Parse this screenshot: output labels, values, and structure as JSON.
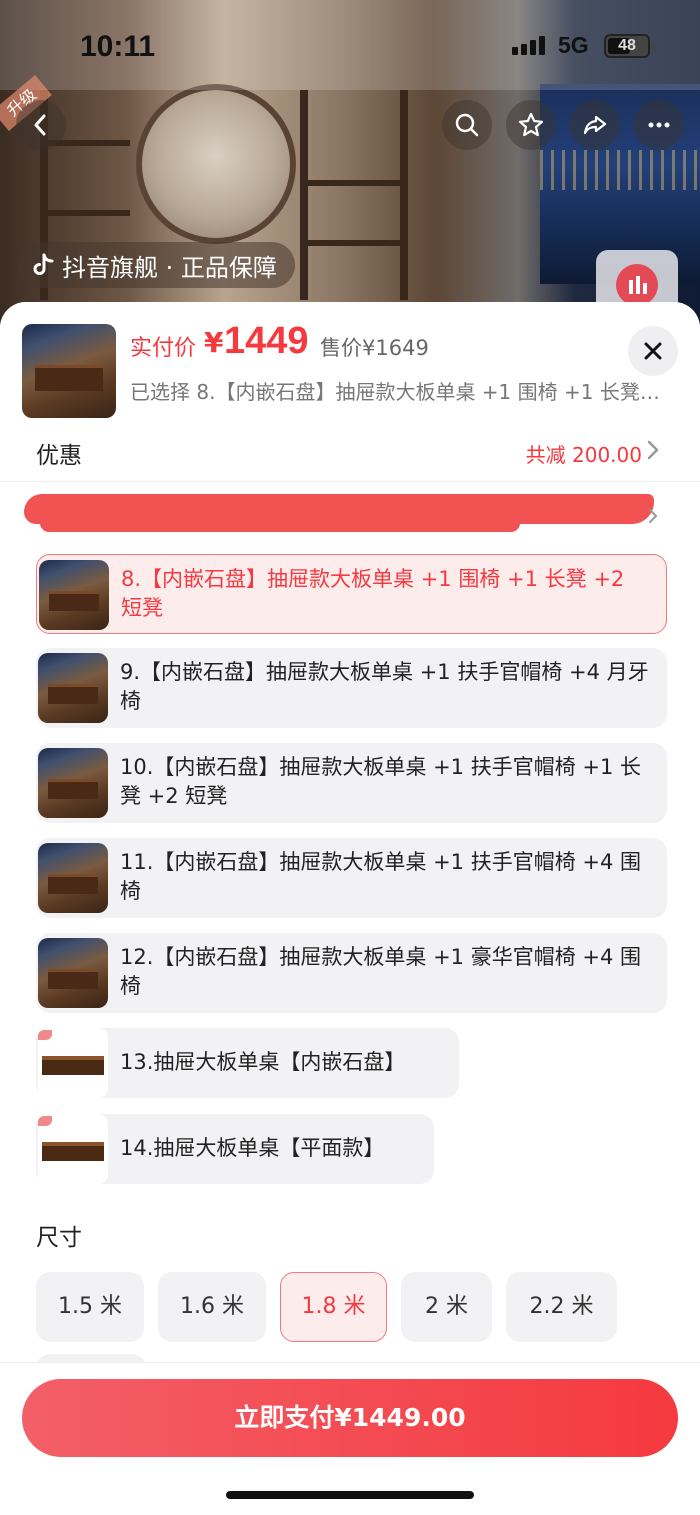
{
  "status_bar": {
    "time": "10:11",
    "network": "5G",
    "battery": "48"
  },
  "header_photo": {
    "badge_text": "升级",
    "store_label": "抖音旗舰 · 正品保障",
    "icons": [
      "back-icon",
      "search-icon",
      "star-icon",
      "share-icon",
      "more-icon"
    ]
  },
  "sheet": {
    "price_label": "实付价",
    "price_yen": "¥",
    "price_value": "1449",
    "original_price": "售价¥1649",
    "selected_summary": "已选择 8.【内嵌石盘】抽屉款大板单桌 +1 围椅 +1 长凳 +...",
    "discount_label": "优惠",
    "discount_value": "共减 200.00",
    "options": [
      {
        "label": "8.【内嵌石盘】抽屉款大板单桌 +1 围椅 +1 长凳 +2 短凳",
        "selected": true
      },
      {
        "label": "9.【内嵌石盘】抽屉款大板单桌 +1 扶手官帽椅 +4 月牙椅",
        "selected": false
      },
      {
        "label": "10.【内嵌石盘】抽屉款大板单桌 +1 扶手官帽椅 +1 长凳 +2 短凳",
        "selected": false
      },
      {
        "label": "11.【内嵌石盘】抽屉款大板单桌 +1 扶手官帽椅 +4 围椅",
        "selected": false
      },
      {
        "label": "12.【内嵌石盘】抽屉款大板单桌 +1 豪华官帽椅 +4 围椅",
        "selected": false
      },
      {
        "label": "13.抽屉大板单桌【内嵌石盘】",
        "selected": false
      },
      {
        "label": "14.抽屉大板单桌【平面款】",
        "selected": false
      }
    ],
    "size_title": "尺寸",
    "sizes": [
      {
        "label": "1.5 米",
        "selected": false
      },
      {
        "label": "1.6 米",
        "selected": false
      },
      {
        "label": "1.8 米",
        "selected": true
      },
      {
        "label": "2 米",
        "selected": false
      },
      {
        "label": "2.2 米",
        "selected": false
      }
    ],
    "pay_button": "立即支付¥1449.00"
  },
  "colors": {
    "accent": "#f5393f",
    "selected_bg": "#fdecec",
    "chip_bg": "#f2f2f4"
  }
}
